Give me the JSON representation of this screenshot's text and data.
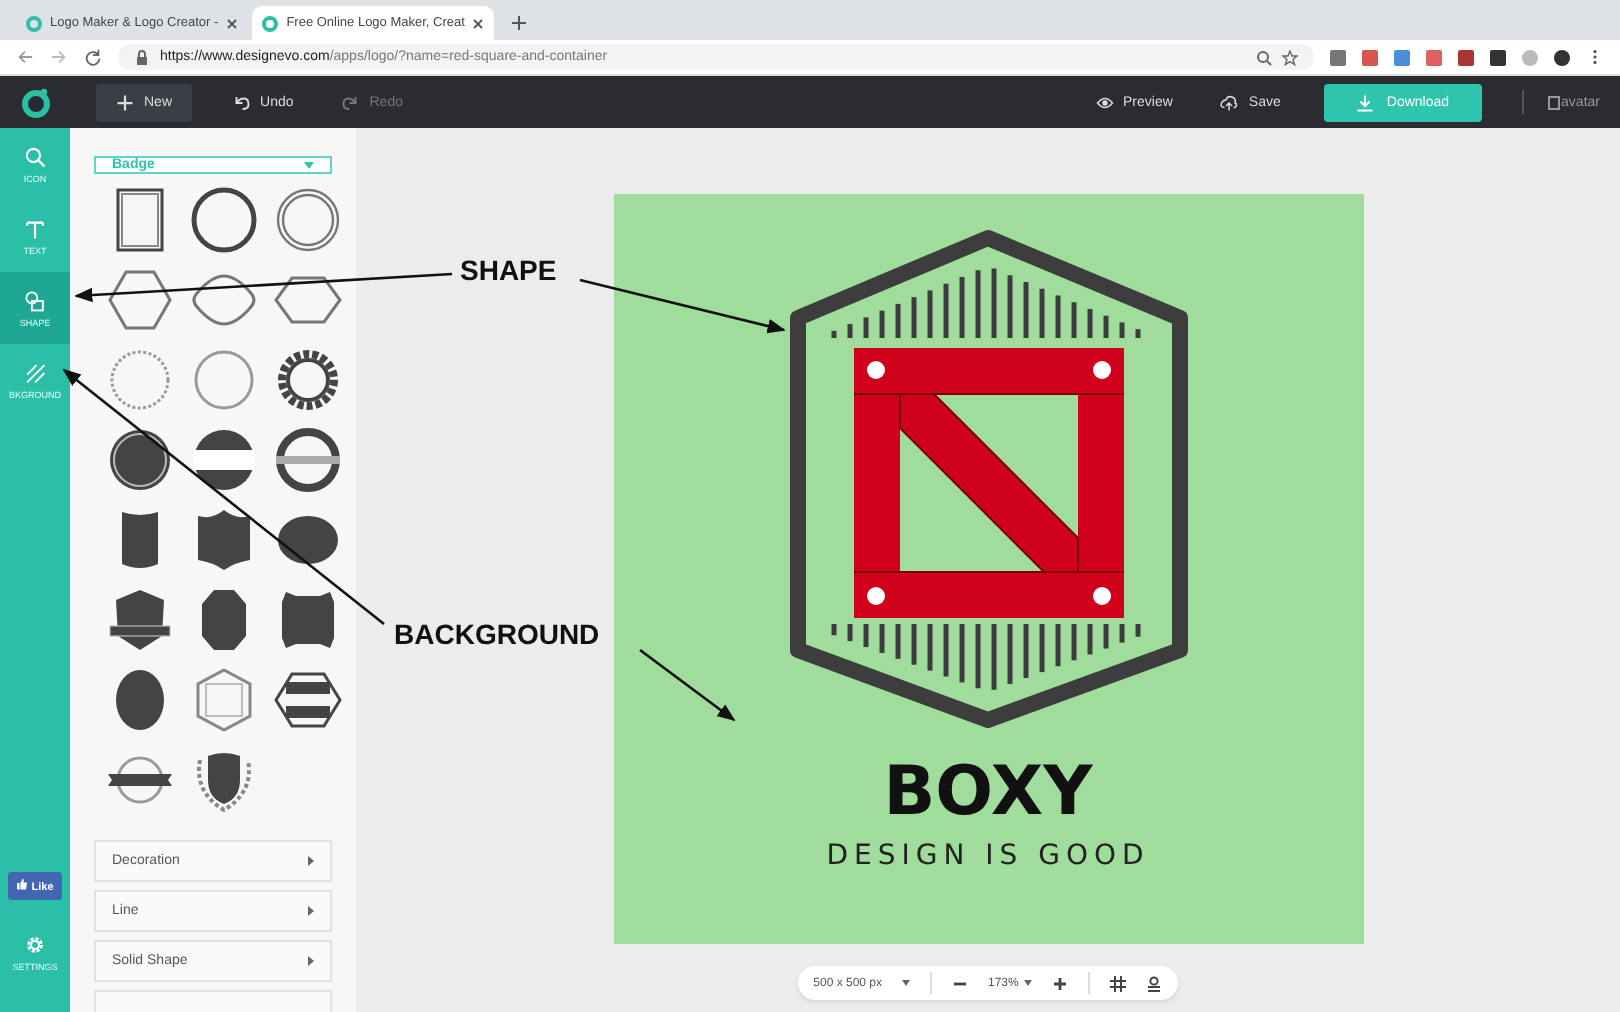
{
  "browser": {
    "tabs": [
      {
        "title": "Logo Maker & Logo Creator - ",
        "selected": false
      },
      {
        "title": "Free Online Logo Maker, Creat",
        "selected": true
      }
    ],
    "url": {
      "host": "https://www.designevo.com",
      "path": "/apps/logo/?name=red-square-and-container"
    }
  },
  "toolbar": {
    "buttons": [
      {
        "label": "New",
        "disabled": false
      },
      {
        "label": "Undo",
        "disabled": false
      },
      {
        "label": "Redo",
        "disabled": true
      }
    ],
    "preview": "Preview",
    "save": "Save",
    "download": "Download",
    "avatar_alt": "avatar"
  },
  "rail": {
    "items": [
      {
        "label": "ICON",
        "kind": "icon",
        "selected": false
      },
      {
        "label": "TEXT",
        "kind": "text",
        "selected": false
      },
      {
        "label": "SHAPE",
        "kind": "shape",
        "selected": true
      },
      {
        "label": "BKGROUND",
        "kind": "background",
        "selected": false
      }
    ],
    "like": "Like",
    "settings": "SETTINGS"
  },
  "panel": {
    "dropdown": "Badge",
    "shapes": [
      {
        "kind": "square-frame"
      },
      {
        "kind": "circle-thick"
      },
      {
        "kind": "circle-double"
      },
      {
        "kind": "hexagon"
      },
      {
        "kind": "rounded-diamond"
      },
      {
        "kind": "hex-wide"
      },
      {
        "kind": "circle-dotted"
      },
      {
        "kind": "circle-thin"
      },
      {
        "kind": "gear-ring"
      },
      {
        "kind": "disc"
      },
      {
        "kind": "disc-banded"
      },
      {
        "kind": "ring-banded"
      },
      {
        "kind": "label-tall"
      },
      {
        "kind": "label-notched"
      },
      {
        "kind": "blob"
      },
      {
        "kind": "shield-ribbon"
      },
      {
        "kind": "octagon-tall"
      },
      {
        "kind": "square-notched"
      },
      {
        "kind": "oval-badge"
      },
      {
        "kind": "hex-frame"
      },
      {
        "kind": "hex-banded"
      },
      {
        "kind": "ribbon-circle"
      },
      {
        "kind": "laurel-shield"
      }
    ],
    "sections": [
      "Decoration",
      "Line",
      "Solid Shape"
    ]
  },
  "canvas": {
    "logo": {
      "name": "BOXY",
      "slogan": "DESIGN IS GOOD"
    },
    "size": "500 x 500 px",
    "zoom": "173%"
  },
  "annotations": [
    {
      "label": "SHAPE"
    },
    {
      "label": "BACKGROUND"
    }
  ]
}
